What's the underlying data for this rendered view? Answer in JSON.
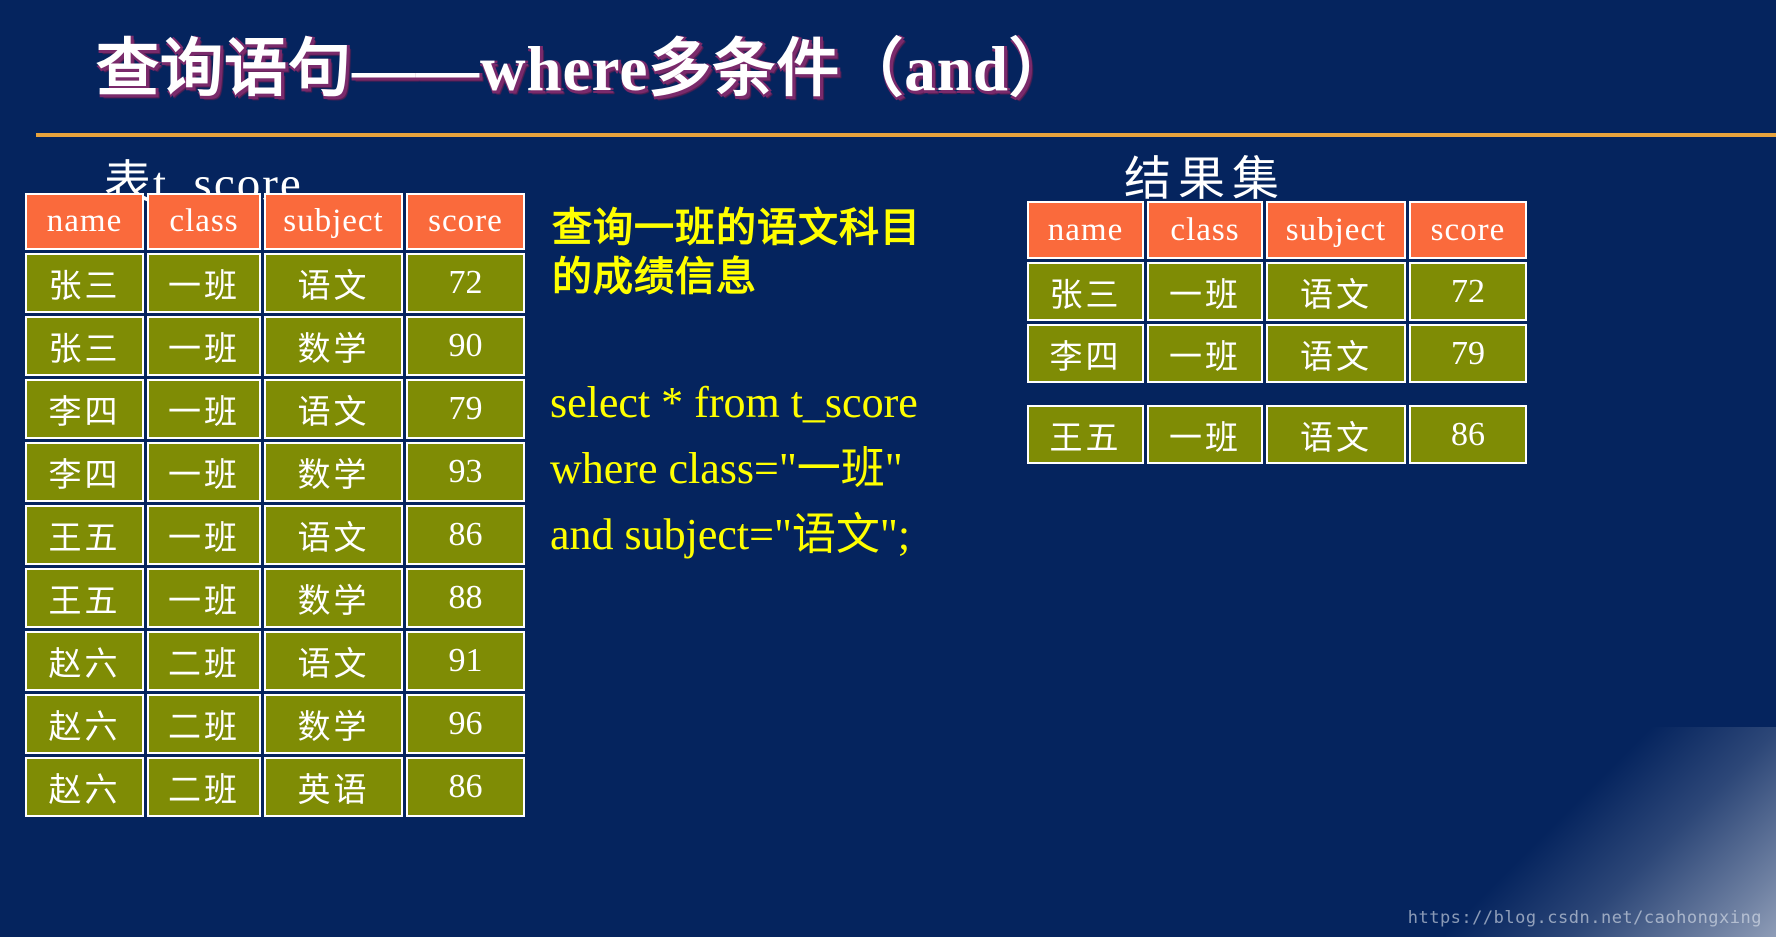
{
  "slide": {
    "title": "查询语句——where多条件（and）",
    "background_color": "#05245e",
    "divider_color": "#e8a33d",
    "title_color": "#ffffff",
    "title_shadow_color": "#7a2a6b",
    "accent_yellow": "#ffff00",
    "header_cell_color": "#fa6a3c",
    "body_cell_color": "#7f8c05"
  },
  "source_table": {
    "caption": "表t_score",
    "columns": [
      "name",
      "class",
      "subject",
      "score"
    ],
    "rows": [
      [
        "张三",
        "一班",
        "语文",
        "72"
      ],
      [
        "张三",
        "一班",
        "数学",
        "90"
      ],
      [
        "李四",
        "一班",
        "语文",
        "79"
      ],
      [
        "李四",
        "一班",
        "数学",
        "93"
      ],
      [
        "王五",
        "一班",
        "语文",
        "86"
      ],
      [
        "王五",
        "一班",
        "数学",
        "88"
      ],
      [
        "赵六",
        "二班",
        "语文",
        "91"
      ],
      [
        "赵六",
        "二班",
        "数学",
        "96"
      ],
      [
        "赵六",
        "二班",
        "英语",
        "86"
      ]
    ]
  },
  "result_table": {
    "caption": "结果集",
    "columns": [
      "name",
      "class",
      "subject",
      "score"
    ],
    "rows": [
      [
        "张三",
        "一班",
        "语文",
        "72"
      ],
      [
        "李四",
        "一班",
        "语文",
        "79"
      ]
    ],
    "extra_rows": [
      [
        "王五",
        "一班",
        "语文",
        "86"
      ]
    ]
  },
  "explanation": {
    "line1": "查询一班的语文科目",
    "line2": "的成绩信息"
  },
  "sql": {
    "line1": "select * from t_score",
    "line2": "where class=\"一班\"",
    "line3": "and subject=\"语文\";"
  },
  "watermark": {
    "url": "https://blog.csdn.net/caohongxing"
  }
}
